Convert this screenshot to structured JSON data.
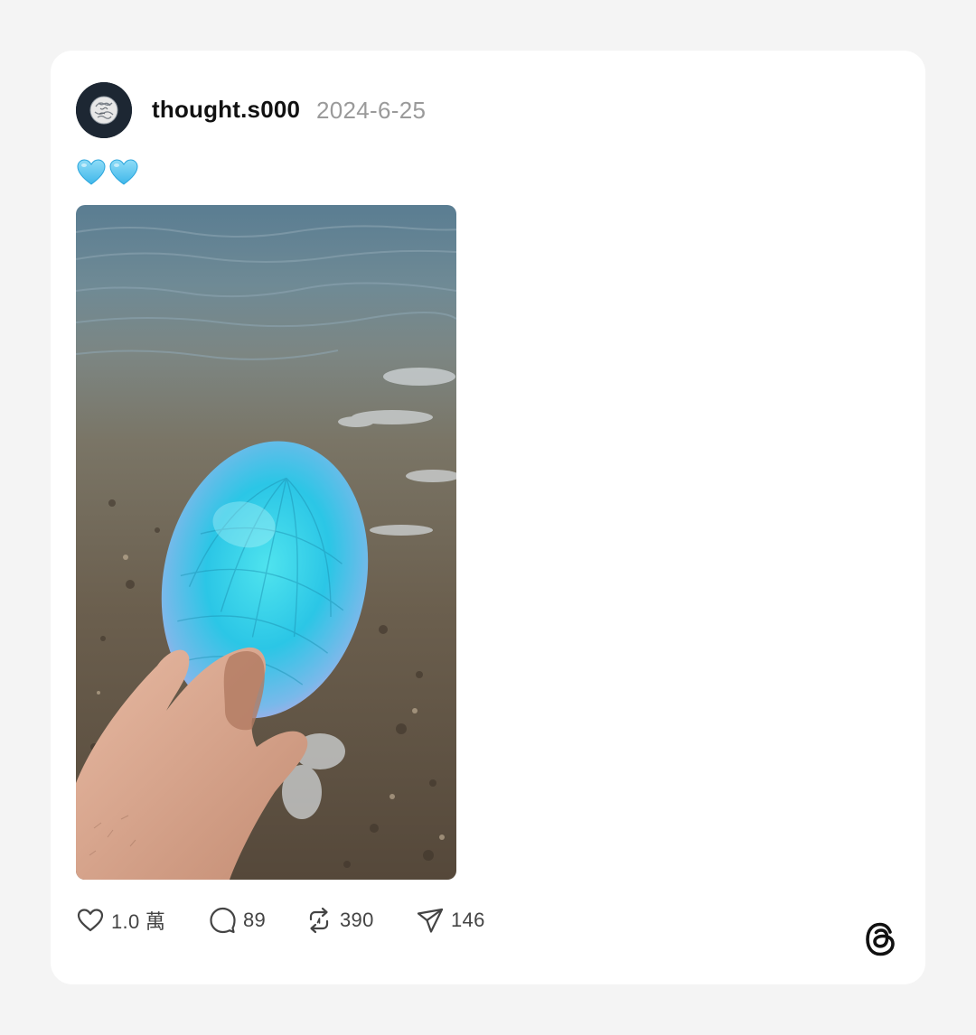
{
  "post": {
    "username": "thought.s000",
    "date": "2024-6-25",
    "text_emojis": [
      "blue-heart",
      "blue-heart"
    ],
    "media": {
      "type": "video-still",
      "content": "hand holding iridescent blue shell at shoreline"
    }
  },
  "actions": {
    "likes": "1.0 萬",
    "replies": "89",
    "reposts": "390",
    "shares": "146"
  },
  "colors": {
    "background": "#f4f4f4",
    "card": "#ffffff",
    "username": "#111111",
    "date": "#9a9a9a",
    "heart_emoji": "#5cc8f0",
    "icon": "#444444"
  },
  "icons": {
    "like": "heart-outline-icon",
    "reply": "speech-bubble-icon",
    "repost": "repost-arrows-icon",
    "share": "paper-plane-icon",
    "brand": "threads-logo-icon"
  }
}
